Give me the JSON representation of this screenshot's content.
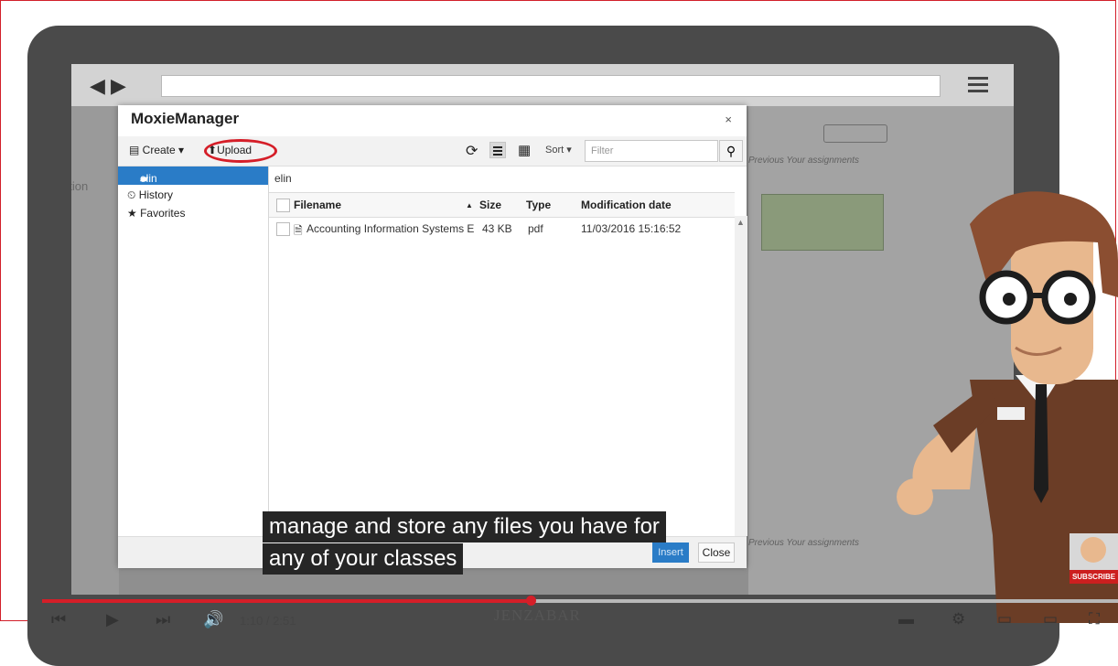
{
  "dialog": {
    "title": "MoxieManager",
    "close_glyph": "×",
    "toolbar": {
      "create_label": "Create",
      "upload_label": "Upload",
      "sort_label": "Sort",
      "filter_placeholder": "Filter",
      "view_mode_selected": "list"
    },
    "sidebar": {
      "items": [
        {
          "label": "elin",
          "icon": "folder-icon",
          "active": true
        },
        {
          "label": "History",
          "icon": "history-icon",
          "active": false
        },
        {
          "label": "Favorites",
          "icon": "star-icon",
          "active": false
        }
      ]
    },
    "breadcrumb": "elin",
    "table": {
      "columns": [
        "Filename",
        "Size",
        "Type",
        "Modification date"
      ],
      "sort_column": "Filename",
      "rows": [
        {
          "filename": "Accounting Information Systems E",
          "size": "43 KB",
          "type": "pdf",
          "modified": "11/03/2016 15:16:52",
          "icon": "pdf-file-icon"
        }
      ]
    },
    "footer": {
      "insert_label": "Insert",
      "close_label": "Close"
    }
  },
  "background": {
    "left_text": "ation",
    "right_text_top": "Previous   Your assignments",
    "right_text_bottom": "Previous   Your assignments"
  },
  "captions": {
    "line1": "manage and store any files you have for",
    "line2": "any of your classes"
  },
  "player": {
    "time": "1:10 / 2:51",
    "progress": 0.455,
    "logo": "JENZABAR",
    "subscribe_label": "SUBSCRIBE"
  },
  "colors": {
    "accent": "#d51e28",
    "selection": "#2a7cc7",
    "dialog_bg": "#ffffff"
  }
}
